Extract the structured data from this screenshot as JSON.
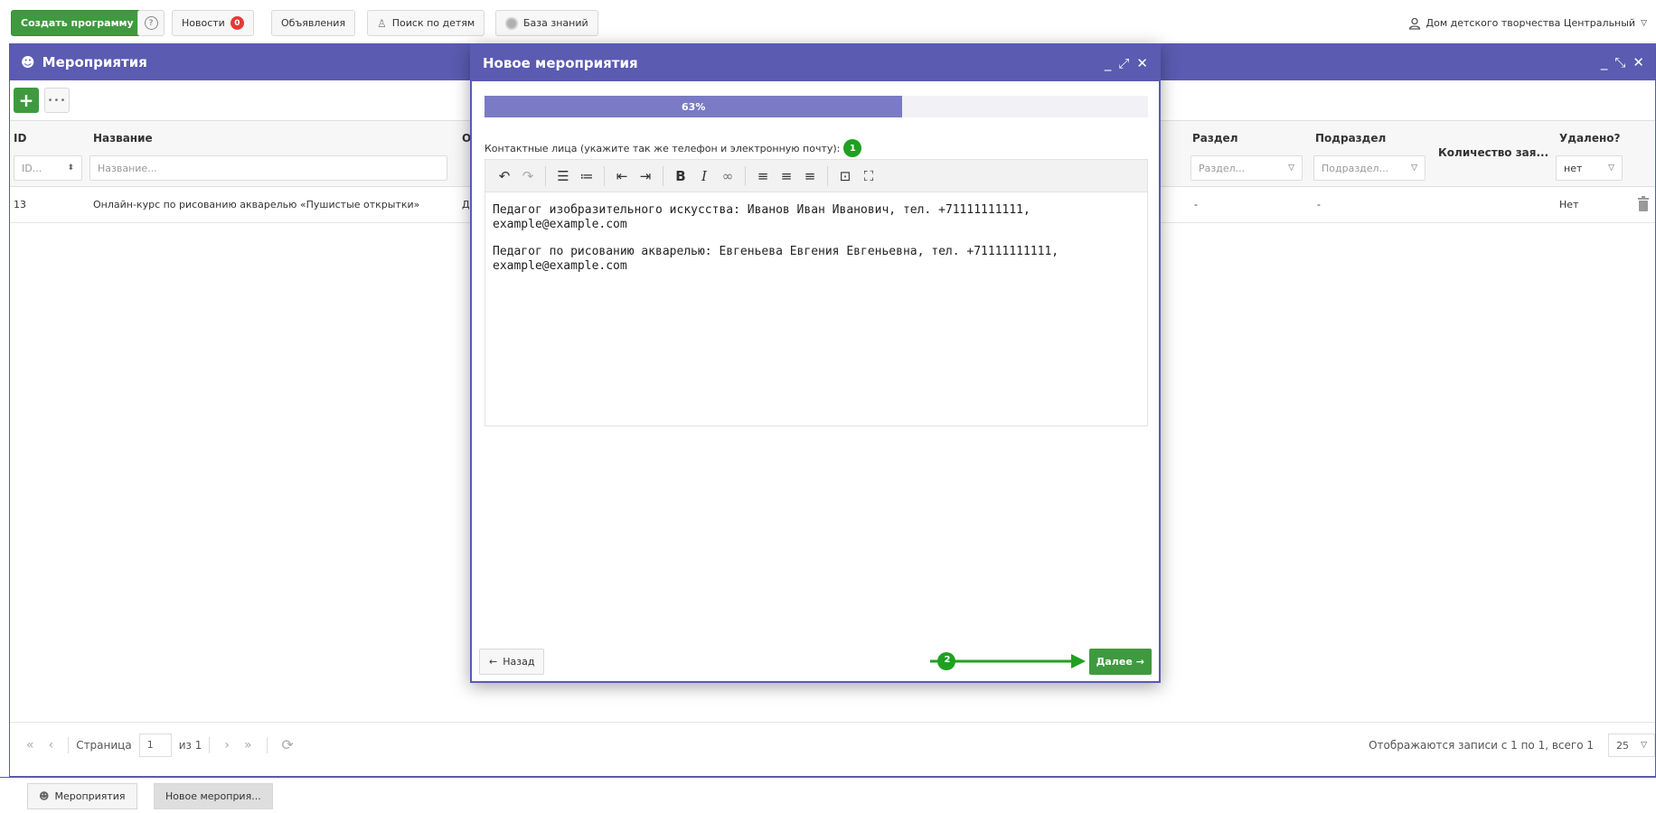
{
  "topbar": {
    "create_label": "Создать программу",
    "help_icon": "question-icon",
    "news_label": "Новости",
    "news_count": "0",
    "ads_label": "Объявления",
    "children_search_label": "Поиск по детям",
    "knowledge_label": "База знаний",
    "org_name": "Дом детского творчества Центральный"
  },
  "events_window": {
    "title": "Мероприятия",
    "columns": {
      "id": "ID",
      "name": "Название",
      "o": "О",
      "razdel": "Раздел",
      "podrazdel": "Подраздел",
      "count": "Количество зая...",
      "deleted": "Удалено?"
    },
    "filters": {
      "id_placeholder": "ID...",
      "name_placeholder": "Название...",
      "razdel_placeholder": "Раздел...",
      "podrazdel_placeholder": "Подраздел...",
      "deleted_value": "нет"
    },
    "rows": [
      {
        "id": "13",
        "name": "Онлайн-курс по рисованию акварелью «Пушистые открытки»",
        "o": "Д",
        "razdel": "-",
        "podrazdel": "-",
        "deleted": "Нет"
      }
    ],
    "pager": {
      "page_label": "Страница",
      "page_value": "1",
      "of_label": "из 1",
      "records_text": "Отображаются записи с 1 по 1, всего 1",
      "page_size": "25"
    }
  },
  "taskbar": {
    "tab1": "Мероприятия",
    "tab2": "Новое мероприя..."
  },
  "modal": {
    "title": "Новое мероприятия",
    "progress_value": 63,
    "progress_label": "63%",
    "field_label": "Контактные лица (укажите так же телефон и электронную почту):",
    "anno1": "1",
    "anno2": "2",
    "editor_paragraphs": [
      "Педагог изобразительного искусства: Иванов Иван Иванович, тел. +71111111111,\nexample@example.com",
      "Педагог по рисованию акварелью: Евгеньева Евгения Евгеньевна, тел. +71111111111,\nexample@example.com"
    ],
    "back_label": "Назад",
    "next_label": "Далее"
  },
  "colors": {
    "header": "#5a5bb1",
    "green": "#3f9a3f",
    "annotation_green": "#20a020",
    "progress_fill": "#7a7bc4"
  }
}
